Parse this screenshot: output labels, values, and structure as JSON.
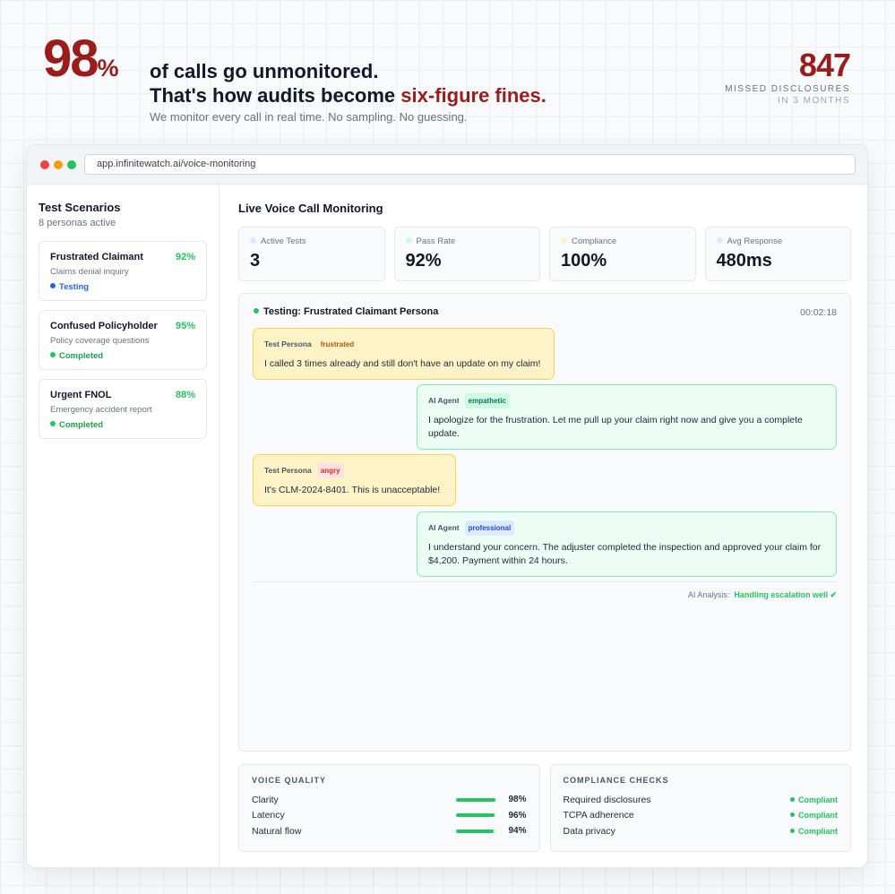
{
  "hero": {
    "big_number": "98",
    "big_unit": "%",
    "headline_line1": "of calls go unmonitored.",
    "headline_line2_prefix": "That's how audits become ",
    "headline_line2_accent": "six-figure fines.",
    "subline": "We monitor every call in real time. No sampling. No guessing.",
    "side_number": "847",
    "side_label1": "MISSED DISCLOSURES",
    "side_label2": "IN 3 MONTHS",
    "accent_color": "#9b1c1c"
  },
  "browser": {
    "url": "app.infinitewatch.ai/voice-monitoring"
  },
  "sidebar": {
    "title": "Test Scenarios",
    "subtitle": "8 personas active",
    "scenarios": [
      {
        "name": "Frustrated Claimant",
        "score": "92%",
        "desc": "Claims denial inquiry",
        "status": "Testing"
      },
      {
        "name": "Confused Policyholder",
        "score": "95%",
        "desc": "Policy coverage questions",
        "status": "Completed"
      },
      {
        "name": "Urgent FNOL",
        "score": "88%",
        "desc": "Emergency accident report",
        "status": "Completed"
      }
    ]
  },
  "main": {
    "title": "Live Voice Call Monitoring",
    "metrics": [
      {
        "label": "Active Tests",
        "value": "3",
        "dot_color": "#dbeafe"
      },
      {
        "label": "Pass Rate",
        "value": "92%",
        "dot_color": "#d1fae5"
      },
      {
        "label": "Compliance",
        "value": "100%",
        "dot_color": "#fef3c7"
      },
      {
        "label": "Avg Response",
        "value": "480ms",
        "dot_color": "#e0e7ff"
      }
    ],
    "call": {
      "heading": "Testing: Frustrated Claimant Persona",
      "timer": "00:02:18",
      "messages": [
        {
          "role": "persona",
          "speaker": "Test Persona",
          "tag": "frustrated",
          "text": "I called 3 times already and still don't have an update on my claim!"
        },
        {
          "role": "agent",
          "speaker": "AI Agent",
          "tag": "empathetic",
          "text": "I apologize for the frustration. Let me pull up your claim right now and give you a complete update."
        },
        {
          "role": "persona",
          "speaker": "Test Persona",
          "tag": "angry",
          "text": "It's CLM-2024-8401. This is unacceptable!"
        },
        {
          "role": "agent",
          "speaker": "AI Agent",
          "tag": "professional",
          "text": "I understand your concern. The adjuster completed the inspection and approved your claim for $4,200. Payment within 24 hours."
        }
      ],
      "analysis_label": "AI Analysis:",
      "analysis_value": "Handling escalation well ✔"
    },
    "voice_quality": {
      "title": "VOICE QUALITY",
      "rows": [
        {
          "label": "Clarity",
          "value": "98%",
          "level": 0.98
        },
        {
          "label": "Latency",
          "value": "96%",
          "level": 0.96
        },
        {
          "label": "Natural flow",
          "value": "94%",
          "level": 0.94
        }
      ]
    },
    "compliance_checks": {
      "title": "COMPLIANCE CHECKS",
      "rows": [
        {
          "label": "Required disclosures",
          "status": "Compliant"
        },
        {
          "label": "TCPA adherence",
          "status": "Compliant"
        },
        {
          "label": "Data privacy",
          "status": "Compliant"
        }
      ]
    }
  }
}
